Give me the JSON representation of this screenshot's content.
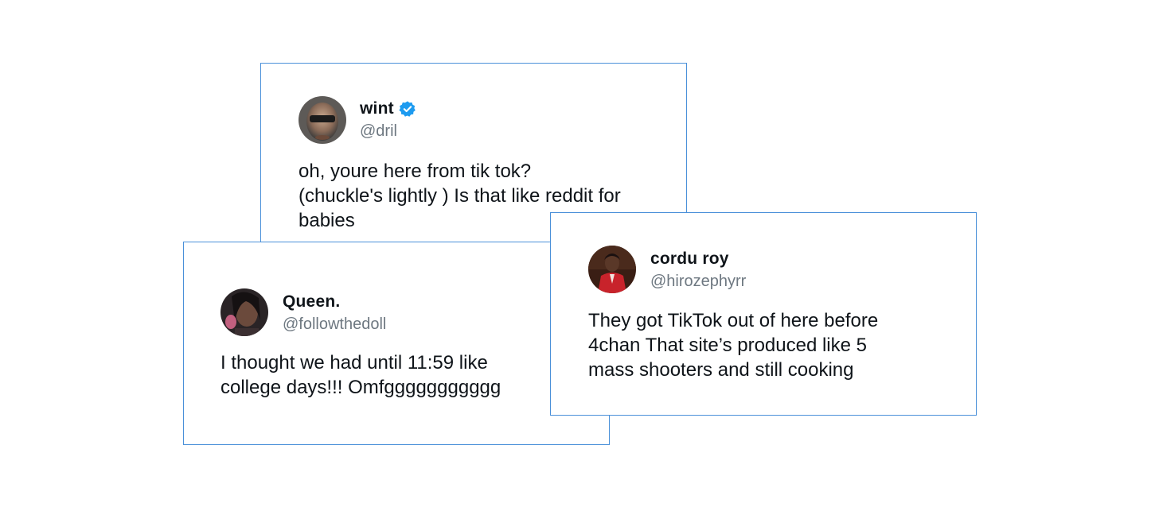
{
  "tweets": [
    {
      "display_name": "wint",
      "handle": "@dril",
      "verified": true,
      "text": "oh, youre here from tik tok?\n(chuckle's lightly ) Is that like reddit for\nbabies"
    },
    {
      "display_name": "Queen.",
      "handle": "@followthedoll",
      "verified": false,
      "text": "I thought we had until 11:59 like\ncollege days!!! Omfggggggggggg"
    },
    {
      "display_name": "cordu roy",
      "handle": "@hirozephyrr",
      "verified": false,
      "text": "They got TikTok out of here before\n4chan   That site’s produced like 5\nmass shooters and still cooking"
    }
  ],
  "colors": {
    "card_border": "#4a90d9",
    "verified_badge": "#1d9bf0",
    "handle_text": "#6e7881",
    "body_text": "#0f1419"
  },
  "icons": {
    "verified": "verified-badge-icon"
  }
}
